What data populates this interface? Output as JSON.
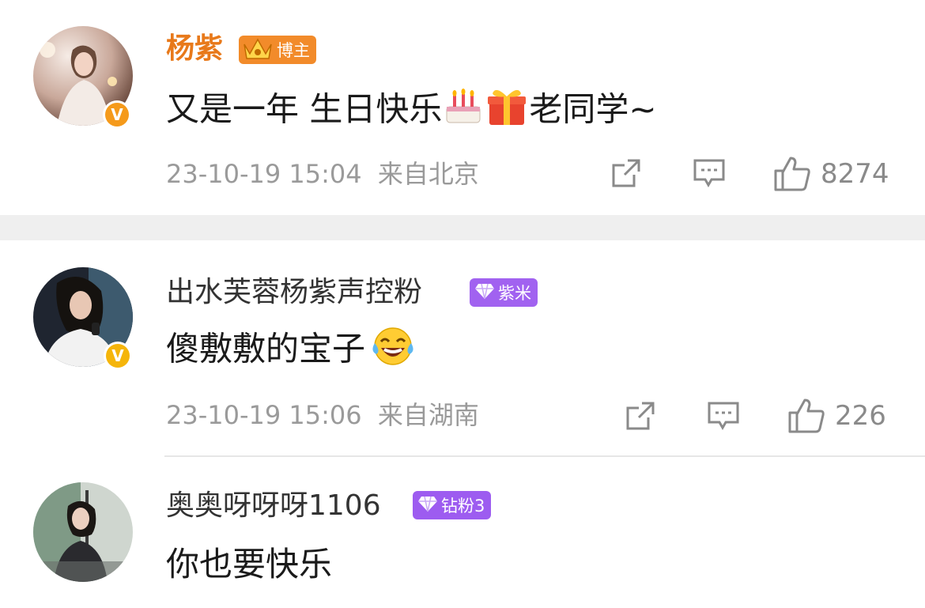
{
  "comments": [
    {
      "username": "杨紫",
      "badge_label": "博主",
      "badge_icon": "crown-icon",
      "verified_color": "#f5a623",
      "text": "又是一年 生日快乐",
      "emojis": [
        "birthday-cake-emoji",
        "gift-emoji"
      ],
      "text_after": "老同学~",
      "timestamp": "23-10-19 15:04",
      "location": "来自北京",
      "likes": "8274"
    },
    {
      "username": "出水芙蓉杨紫声控粉",
      "badge_label": "紫米",
      "badge_icon": "diamond-icon",
      "verified_color": "#f5b50a",
      "text": "傻敷敷的宝子",
      "emojis": [
        "laughing-tears-emoji"
      ],
      "timestamp": "23-10-19 15:06",
      "location": "来自湖南",
      "likes": "226"
    },
    {
      "username": "奥奥呀呀呀1106",
      "badge_label": "钻粉3",
      "badge_icon": "diamond-icon",
      "text": "你也要快乐"
    }
  ],
  "colors": {
    "blogger_name": "#e8791a",
    "blogger_badge": "#f28b2a",
    "fan_badge": "#9d5cf0",
    "meta_text": "#9a9a9a",
    "section_gap": "#efefef"
  },
  "icons": {
    "share": "share-icon",
    "comment": "comment-icon",
    "like": "thumbs-up-icon"
  }
}
